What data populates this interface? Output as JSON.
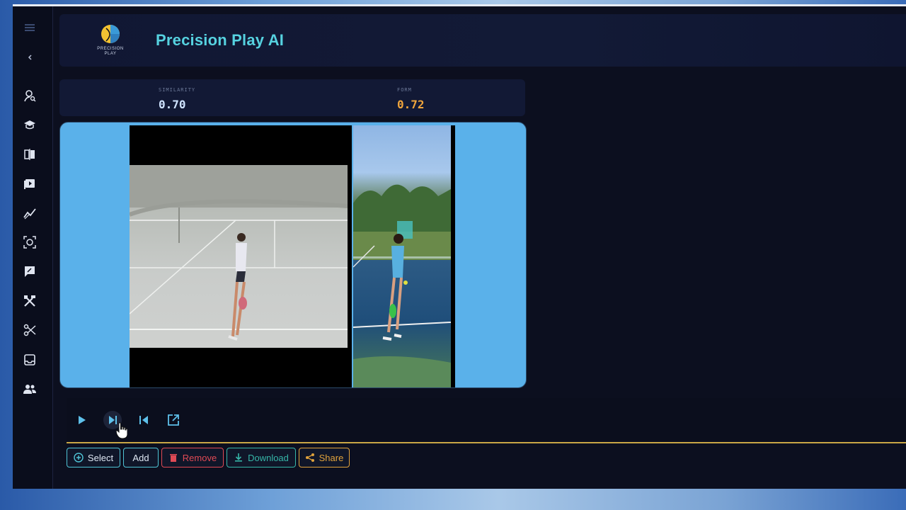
{
  "app": {
    "title": "Precision Play AI",
    "logo_text": "PRECISION PLAY",
    "accent": "#56d2e0"
  },
  "sidebar": {
    "items": [
      {
        "icon": "menu-icon"
      },
      {
        "icon": "collapse-arrow-icon"
      },
      {
        "icon": "user-search-icon"
      },
      {
        "icon": "graduation-cap-icon"
      },
      {
        "icon": "compare-icon"
      },
      {
        "icon": "video-library-icon"
      },
      {
        "icon": "analytics-icon"
      },
      {
        "icon": "ai-detect-icon"
      },
      {
        "icon": "feedback-icon"
      },
      {
        "icon": "tools-icon"
      },
      {
        "icon": "scissors-icon"
      },
      {
        "icon": "inbox-icon"
      },
      {
        "icon": "users-icon"
      }
    ]
  },
  "metrics": {
    "similarity": {
      "label": "SIMILARITY",
      "value": "0.70",
      "color": "#cfe3ff"
    },
    "form": {
      "label": "FORM",
      "value": "0.72",
      "color": "#f0a53c"
    }
  },
  "playback": {
    "play": "play-icon",
    "next_frame": "skip-forward-icon",
    "prev_frame": "skip-back-icon",
    "open_external": "external-link-icon"
  },
  "actions": {
    "select": "Select",
    "add": "Add",
    "remove": "Remove",
    "download": "Download",
    "share": "Share"
  },
  "colors": {
    "select": "#4fc4d6",
    "add": "#4fc4d6",
    "remove": "#e04a55",
    "download": "#36b6a8",
    "share": "#e0a23c",
    "video_bg": "#5ab1ea"
  }
}
